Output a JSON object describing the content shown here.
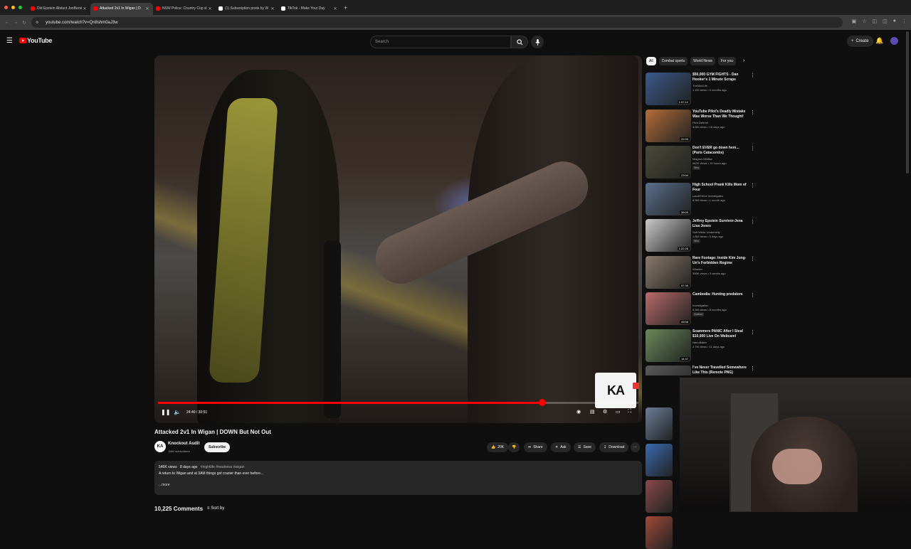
{
  "browser": {
    "tabs": [
      {
        "title": "Did Epstein Abduct JonBenét",
        "active": false,
        "favicon_color": "#ff0000"
      },
      {
        "title": "Attacked 2v1 In Wigan | D",
        "active": true,
        "favicon_color": "#ff0000"
      },
      {
        "title": "NSW Police: Country Cop sl",
        "active": false,
        "favicon_color": "#ff0000"
      },
      {
        "title": "(1) Subscription posts by W",
        "active": false,
        "favicon_color": "#ffffff"
      },
      {
        "title": "TikTok - Make Your Day",
        "active": false,
        "favicon_color": "#ffffff"
      }
    ],
    "new_tab_icon": "+",
    "url": "youtube.com/watch?v=Qn8shm0aJ3w"
  },
  "header": {
    "logo_text": "YouTube",
    "search_placeholder": "Search",
    "create_label": "Create"
  },
  "player": {
    "current_time": "24:40",
    "duration": "30:51",
    "time_display": "24:40 / 30:51",
    "progress_fraction": 0.8,
    "overlay_logo": "KA",
    "accent": "#ff0000"
  },
  "video": {
    "title": "Attacked 2v1 In Wigan | DOWN But Not Out",
    "channel": {
      "name": "Knockout Audit",
      "subscribers": "116K subscribers",
      "avatar_text": "KA"
    },
    "subscribe_label": "Subscribe",
    "actions": {
      "likes": "20K",
      "share": "Share",
      "ask": "Ask",
      "save": "Save",
      "download": "Download"
    },
    "description": {
      "views": "546K views",
      "date": "8 days ago",
      "tags": "#nightlife #madness #wigan",
      "text": "A return to Wigan and at 3AM things got crazier than ever before...",
      "more": "...more"
    },
    "comments_count": "10,225 Comments",
    "sort_label": "Sort by"
  },
  "sidebar": {
    "chips": [
      "All",
      "Combat sports",
      "World News",
      "For you"
    ],
    "recommendations": [
      {
        "title": "$50,000 GYM FIGHTS - Dan Hooker's 1 Minute Scraps",
        "channel": "TheMacLife",
        "meta": "1.1M views • 5 months ago",
        "duration": "1:57:12",
        "badge": "",
        "thumb": "#3a5a8a"
      },
      {
        "title": "YouTube Pilot's Deadly Mistake Was Worse Than We Thought!",
        "channel": "Pilot Debrief",
        "meta": "3.6M views • 16 days ago",
        "duration": "22:53",
        "badge": "",
        "thumb": "#b46d3a"
      },
      {
        "title": "Don't EVER go down here... (Paris Catacombs)",
        "channel": "Magnus Midtbø",
        "meta": "562K views • 19 hours ago",
        "duration": "23:04",
        "badge": "New",
        "thumb": "#4a4a3a"
      },
      {
        "title": "High School Prank Kills Mom of Four",
        "channel": "Law&Crime Investigates",
        "meta": "8.5M views • 1 month ago",
        "duration": "36:09",
        "badge": "",
        "thumb": "#5a6f8e"
      },
      {
        "title": "Jeffrey Epstein Survivor-Jena Lisa Jones",
        "channel": "Soft White Underbelly",
        "meta": "1.8M views • 5 days ago",
        "duration": "1:22:26",
        "badge": "New",
        "thumb": "#c9c9c9"
      },
      {
        "title": "Rare Footage: Inside Kim Jong-Un's Forbidden Regime",
        "channel": "Wonder",
        "meta": "395K views • 3 weeks ago",
        "duration": "57:35",
        "badge": "",
        "thumb": "#8a7a6a"
      },
      {
        "title": "Cambodia: Hunting predators",
        "channel": "Investigation",
        "meta": "6.5M views • 8 months ago",
        "duration": "49:08",
        "badge": "Dubbed",
        "thumb": "#b86a6a"
      },
      {
        "title": "Scammers PANIC After I Steal $10,000 Live On Webcam!",
        "channel": "NanoBaiter",
        "meta": "2.7M views • 11 days ago",
        "duration": "14:47",
        "badge": "",
        "thumb": "#6a8a5a"
      },
      {
        "title": "I've Never Travelled Somewhere Like This (Remote PNG)",
        "channel": "",
        "meta": "",
        "duration": "",
        "badge": "",
        "thumb": "#5a5a5a"
      }
    ],
    "shorts_thumbs": [
      "#6a7e9a",
      "#3a6ab0",
      "#8a4a4a",
      "#a24a3a"
    ]
  }
}
